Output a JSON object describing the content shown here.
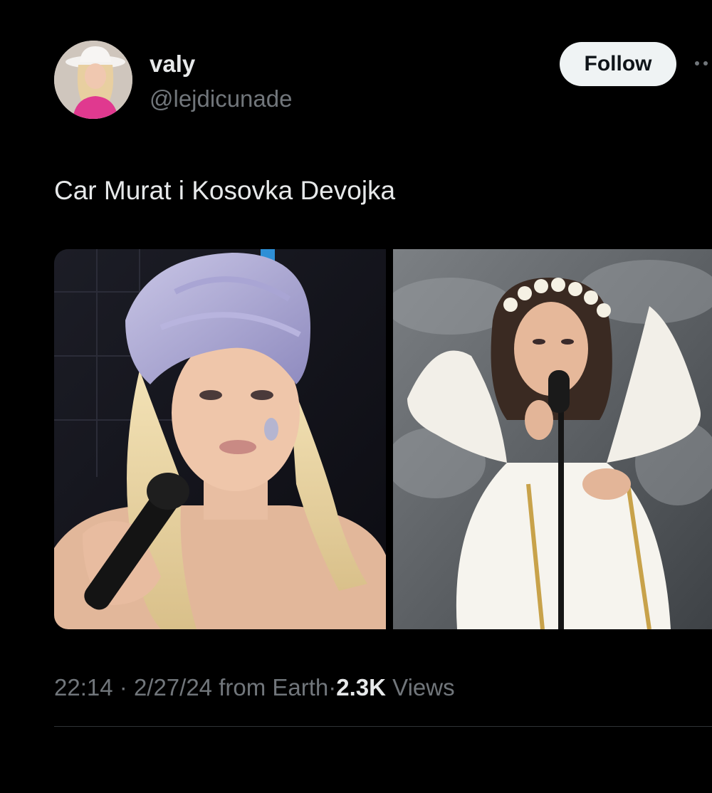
{
  "tweet": {
    "author": {
      "display_name": "valy",
      "handle": "@lejdicunade",
      "avatar_icon": "avatar-image"
    },
    "follow_label": "Follow",
    "more_icon": "more-options-icon",
    "text": "Car Murat i Kosovka Devojka",
    "media": [
      {
        "name": "photo-woman-lilac-turban-microphone"
      },
      {
        "name": "photo-singer-angel-wings-flower-crown"
      }
    ],
    "meta": {
      "time": "22:14",
      "separator": "·",
      "date": "2/27/24",
      "source": "from Earth",
      "views_count": "2.3K",
      "views_label": "Views"
    }
  },
  "colors": {
    "background": "#000000",
    "primary_text": "#e7e9ea",
    "secondary_text": "#71767b",
    "follow_button_bg": "#eff3f4",
    "divider": "#2f3336"
  }
}
